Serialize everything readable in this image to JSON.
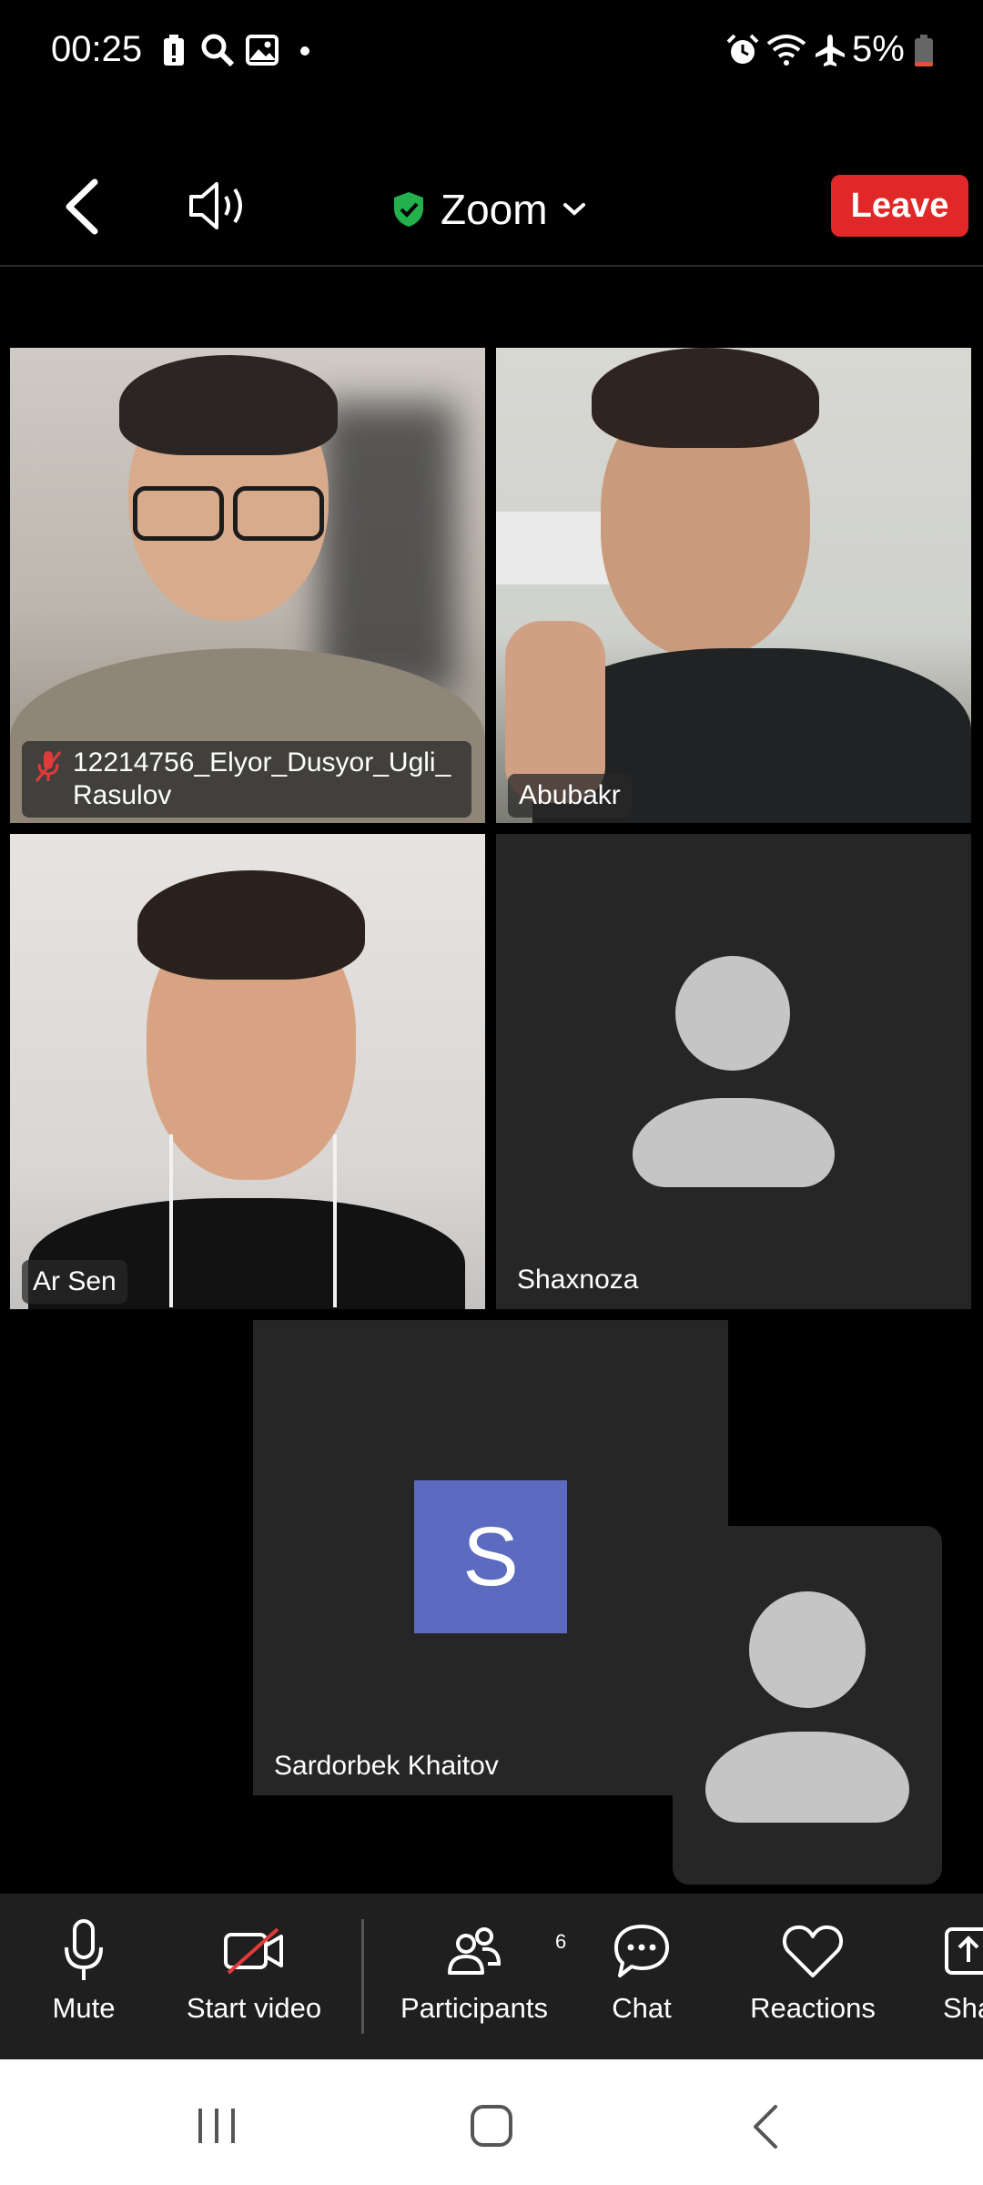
{
  "status_bar": {
    "time": "00:25",
    "battery": "5%",
    "left_icons": [
      "battery-alert-icon",
      "search-icon",
      "image-icon",
      "dot-icon"
    ],
    "right_icons": [
      "alarm-icon",
      "wifi-icon",
      "airplane-icon",
      "battery-icon"
    ]
  },
  "top_bar": {
    "meeting_title": "Zoom",
    "leave_label": "Leave",
    "shield_color": "#22b14c",
    "leave_color": "#e02828"
  },
  "tiles": {
    "elyor": {
      "name_line1": "12214756_Elyor_Dusyor_Ugli_",
      "name_line2": "Rasulov",
      "muted": true
    },
    "abubakr": {
      "name": "Abubakr"
    },
    "arsen": {
      "name": "Ar Sen"
    },
    "shaxnoza": {
      "name": "Shaxnoza"
    },
    "sardorbek": {
      "name": "Sardorbek Khaitov",
      "initial": "S",
      "initial_bg": "#5c6bc0"
    }
  },
  "toolbar": {
    "mute": "Mute",
    "start_video": "Start video",
    "participants": "Participants",
    "participants_count": "6",
    "chat": "Chat",
    "reactions": "Reactions",
    "share": "Sha"
  },
  "nav_bar": {
    "icons": [
      "recents-icon",
      "home-icon",
      "back-icon"
    ]
  }
}
